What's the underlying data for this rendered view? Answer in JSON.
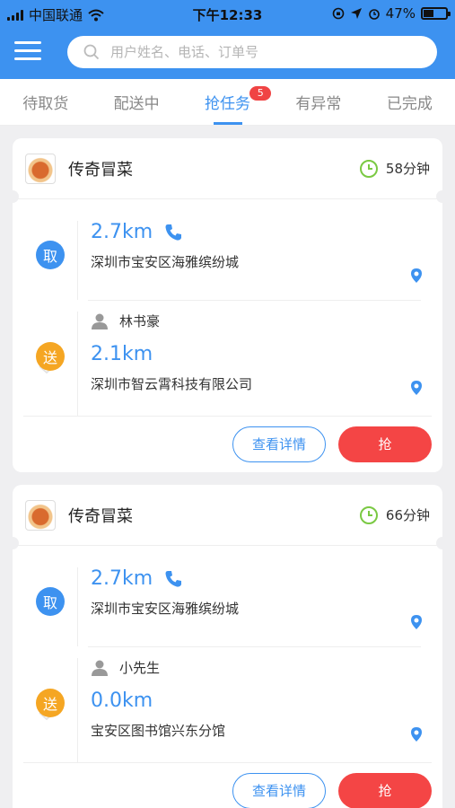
{
  "status_bar": {
    "carrier": "中国联通",
    "time": "下午12:33",
    "battery": "47%",
    "battery_level": 0.47
  },
  "header": {
    "menu_icon": "hamburger-menu-icon",
    "search": {
      "placeholder": "用户姓名、电话、订单号",
      "icon": "search-icon"
    }
  },
  "tabs": [
    {
      "label": "待取货"
    },
    {
      "label": "配送中"
    },
    {
      "label": "抢任务",
      "badge": "5",
      "active": true
    },
    {
      "label": "有异常"
    },
    {
      "label": "已完成"
    }
  ],
  "orders": [
    {
      "shop": "传奇冒菜",
      "time_limit": "58分钟",
      "pickup": {
        "tag": "取",
        "distance": "2.7km",
        "address": "深圳市宝安区海雅缤纷城"
      },
      "delivery": {
        "tag": "送",
        "customer": "林书豪",
        "distance": "2.1km",
        "address": "深圳市智云霄科技有限公司"
      },
      "detail_label": "查看详情",
      "grab_label": "抢"
    },
    {
      "shop": "传奇冒菜",
      "time_limit": "66分钟",
      "pickup": {
        "tag": "取",
        "distance": "2.7km",
        "address": "深圳市宝安区海雅缤纷城"
      },
      "delivery": {
        "tag": "送",
        "customer": "小先生",
        "distance": "0.0km",
        "address": "宝安区图书馆兴东分馆"
      },
      "detail_label": "查看详情",
      "grab_label": "抢"
    }
  ],
  "colors": {
    "primary": "#3d92f0",
    "pickup": "#3d92f0",
    "delivery": "#f5a623",
    "grab": "#f44545",
    "timer": "#7ac943"
  }
}
